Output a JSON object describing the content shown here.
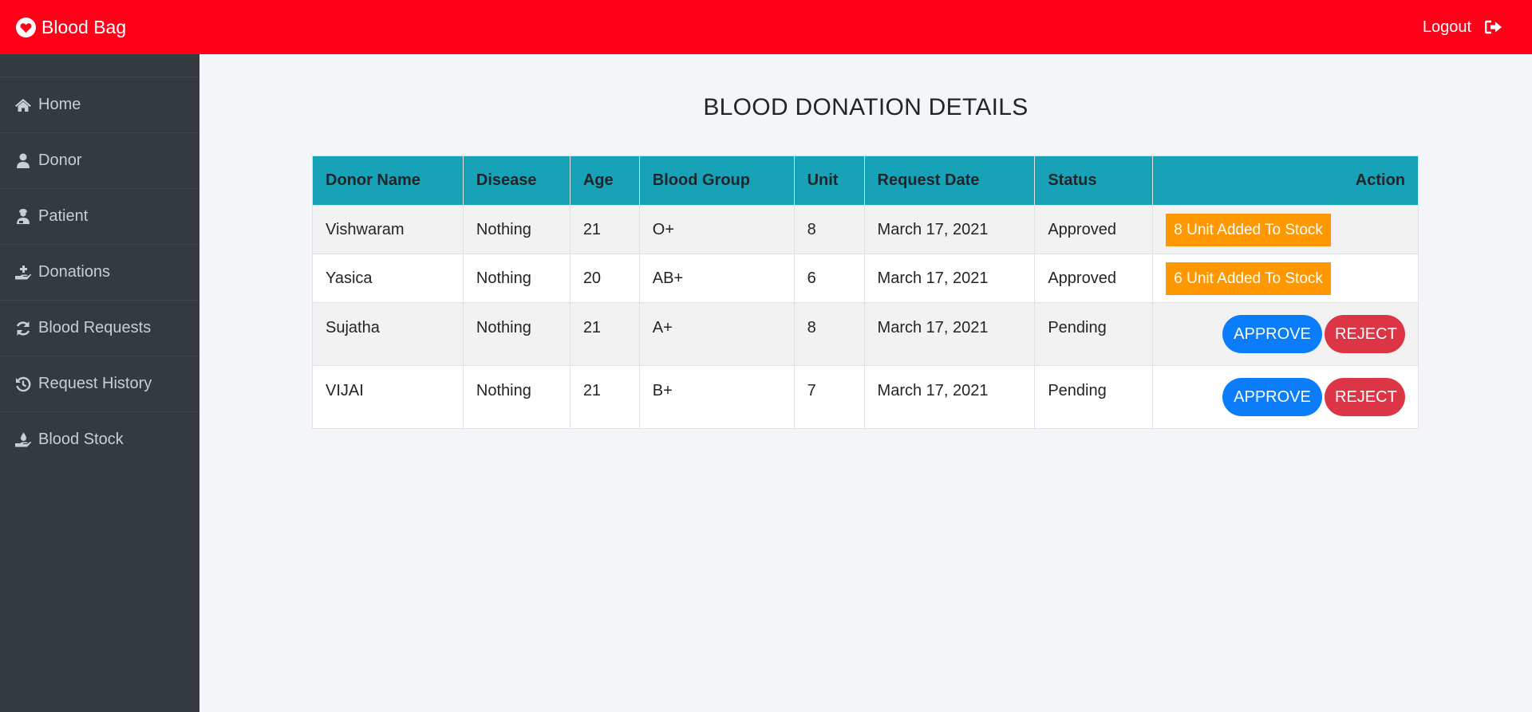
{
  "brand": {
    "name": "Blood Bag",
    "icon": "heart-icon",
    "color": "#ff0019"
  },
  "topbar": {
    "logout_label": "Logout",
    "logout_icon": "sign-out-icon"
  },
  "sidebar": {
    "items": [
      {
        "label": "Home",
        "icon": "home-icon"
      },
      {
        "label": "Donor",
        "icon": "user-icon"
      },
      {
        "label": "Patient",
        "icon": "user-injured-icon"
      },
      {
        "label": "Donations",
        "icon": "hand-holding-medical-icon"
      },
      {
        "label": "Blood Requests",
        "icon": "sync-icon"
      },
      {
        "label": "Request History",
        "icon": "history-icon"
      },
      {
        "label": "Blood Stock",
        "icon": "hand-holding-water-icon"
      }
    ]
  },
  "page": {
    "title": "BLOOD DONATION DETAILS"
  },
  "table": {
    "headers": [
      "Donor Name",
      "Disease",
      "Age",
      "Blood Group",
      "Unit",
      "Request Date",
      "Status",
      "Action"
    ],
    "rows": [
      {
        "name": "Vishwaram",
        "disease": "Nothing",
        "age": "21",
        "blood_group": "O+",
        "unit": "8",
        "date": "March 17, 2021",
        "status": "Approved",
        "action": "8 Unit Added To Stock"
      },
      {
        "name": "Yasica",
        "disease": "Nothing",
        "age": "20",
        "blood_group": "AB+",
        "unit": "6",
        "date": "March 17, 2021",
        "status": "Approved",
        "action": "6 Unit Added To Stock"
      },
      {
        "name": "Sujatha",
        "disease": "Nothing",
        "age": "21",
        "blood_group": "A+",
        "unit": "8",
        "date": "March 17, 2021",
        "status": "Pending",
        "approve_label": "APPROVE",
        "reject_label": "REJECT"
      },
      {
        "name": "VIJAI",
        "disease": "Nothing",
        "age": "21",
        "blood_group": "B+",
        "unit": "7",
        "date": "March 17, 2021",
        "status": "Pending",
        "approve_label": "APPROVE",
        "reject_label": "REJECT"
      }
    ]
  },
  "colors": {
    "header": "#17a2b8",
    "stock_badge": "#ff9800",
    "approve": "#0b7dfa",
    "reject": "#dc3545",
    "sidebar": "#343a40"
  }
}
